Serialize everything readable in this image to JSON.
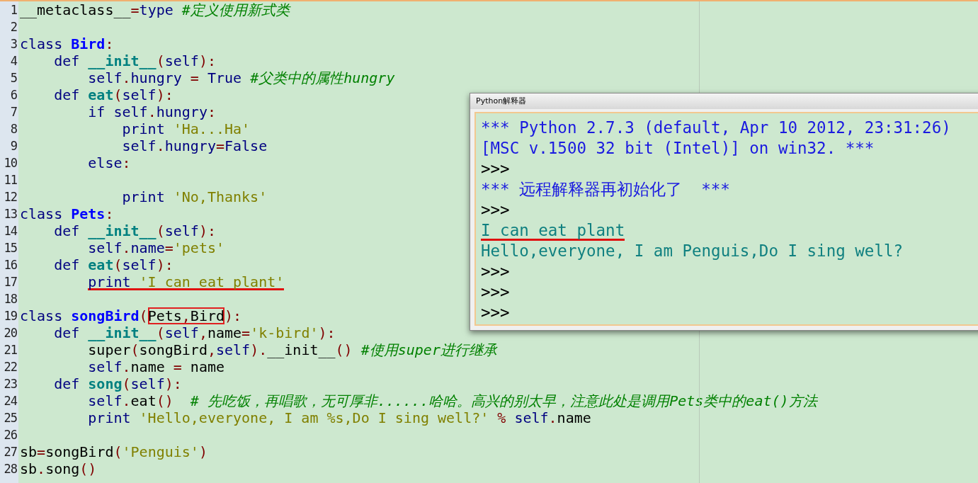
{
  "editor": {
    "lines": [
      {
        "number": "1",
        "tokens": [
          {
            "kind": "name",
            "text": "__metaclass__"
          },
          {
            "kind": "op",
            "text": "="
          },
          {
            "kind": "kw",
            "text": "type "
          },
          {
            "kind": "cmt",
            "text": "#定义使用新式类"
          }
        ]
      },
      {
        "number": "2"
      },
      {
        "number": "3",
        "tokens": [
          {
            "kind": "kw",
            "text": "class "
          },
          {
            "kind": "cls",
            "text": "Bird"
          },
          {
            "kind": "op",
            "text": ":"
          }
        ]
      },
      {
        "number": "4",
        "tokens": [
          {
            "kind": "kw",
            "text": "    def "
          },
          {
            "kind": "fn",
            "text": "__init__"
          },
          {
            "kind": "op",
            "text": "("
          },
          {
            "kind": "kw",
            "text": "self"
          },
          {
            "kind": "op",
            "text": "):"
          }
        ]
      },
      {
        "number": "5",
        "tokens": [
          {
            "kind": "kw",
            "text": "        self"
          },
          {
            "kind": "op",
            "text": "."
          },
          {
            "kind": "kw",
            "text": "hungry "
          },
          {
            "kind": "op",
            "text": "="
          },
          {
            "kind": "kw",
            "text": " True "
          },
          {
            "kind": "cmt",
            "text": "#父类中的属性hungry"
          }
        ]
      },
      {
        "number": "6",
        "tokens": [
          {
            "kind": "kw",
            "text": "    def "
          },
          {
            "kind": "fn",
            "text": "eat"
          },
          {
            "kind": "op",
            "text": "("
          },
          {
            "kind": "kw",
            "text": "self"
          },
          {
            "kind": "op",
            "text": "):"
          }
        ]
      },
      {
        "number": "7",
        "tokens": [
          {
            "kind": "kw",
            "text": "        if self"
          },
          {
            "kind": "op",
            "text": "."
          },
          {
            "kind": "kw",
            "text": "hungry"
          },
          {
            "kind": "op",
            "text": ":"
          }
        ]
      },
      {
        "number": "8",
        "tokens": [
          {
            "kind": "kw",
            "text": "            print "
          },
          {
            "kind": "str",
            "text": "'Ha...Ha'"
          }
        ]
      },
      {
        "number": "9",
        "tokens": [
          {
            "kind": "kw",
            "text": "            self"
          },
          {
            "kind": "op",
            "text": "."
          },
          {
            "kind": "kw",
            "text": "hungry"
          },
          {
            "kind": "op",
            "text": "="
          },
          {
            "kind": "kw",
            "text": "False"
          }
        ]
      },
      {
        "number": "10",
        "tokens": [
          {
            "kind": "kw",
            "text": "        else"
          },
          {
            "kind": "op",
            "text": ":"
          }
        ]
      },
      {
        "number": "11"
      },
      {
        "number": "12",
        "tokens": [
          {
            "kind": "kw",
            "text": "            print "
          },
          {
            "kind": "str",
            "text": "'No,Thanks'"
          }
        ]
      },
      {
        "number": "13",
        "tokens": [
          {
            "kind": "kw",
            "text": "class "
          },
          {
            "kind": "cls",
            "text": "Pets"
          },
          {
            "kind": "op",
            "text": ":"
          }
        ]
      },
      {
        "number": "14",
        "tokens": [
          {
            "kind": "kw",
            "text": "    def "
          },
          {
            "kind": "fn",
            "text": "__init__"
          },
          {
            "kind": "op",
            "text": "("
          },
          {
            "kind": "kw",
            "text": "self"
          },
          {
            "kind": "op",
            "text": "):"
          }
        ]
      },
      {
        "number": "15",
        "tokens": [
          {
            "kind": "kw",
            "text": "        self"
          },
          {
            "kind": "op",
            "text": "."
          },
          {
            "kind": "kw",
            "text": "name"
          },
          {
            "kind": "op",
            "text": "="
          },
          {
            "kind": "str",
            "text": "'pets'"
          }
        ]
      },
      {
        "number": "16",
        "tokens": [
          {
            "kind": "kw",
            "text": "    def "
          },
          {
            "kind": "fn",
            "text": "eat"
          },
          {
            "kind": "op",
            "text": "("
          },
          {
            "kind": "kw",
            "text": "self"
          },
          {
            "kind": "op",
            "text": "):"
          }
        ]
      },
      {
        "number": "17",
        "tokens": [
          {
            "underlined": true,
            "boxed": false,
            "parts": [
              {
                "kind": "kw",
                "text": "        print "
              },
              {
                "kind": "str",
                "text": "'I can eat plant'"
              }
            ]
          }
        ]
      },
      {
        "number": "18"
      },
      {
        "number": "19",
        "tokens": [
          {
            "kind": "kw",
            "text": "class "
          },
          {
            "kind": "cls",
            "text": "songBird"
          },
          {
            "kind": "op",
            "text": "("
          },
          {
            "underlined": false,
            "boxed": true,
            "parts": [
              {
                "kind": "name",
                "text": "Pets"
              },
              {
                "kind": "op",
                "text": ","
              },
              {
                "kind": "name",
                "text": "Bird"
              }
            ]
          },
          {
            "kind": "op",
            "text": "):"
          }
        ]
      },
      {
        "number": "20",
        "tokens": [
          {
            "kind": "kw",
            "text": "    def "
          },
          {
            "kind": "fn",
            "text": "__init__"
          },
          {
            "kind": "op",
            "text": "("
          },
          {
            "kind": "kw",
            "text": "self"
          },
          {
            "kind": "op",
            "text": ","
          },
          {
            "kind": "name",
            "text": "name"
          },
          {
            "kind": "op",
            "text": "="
          },
          {
            "kind": "str",
            "text": "'k-bird'"
          },
          {
            "kind": "op",
            "text": "):"
          }
        ]
      },
      {
        "number": "21",
        "tokens": [
          {
            "kind": "name",
            "text": "        super"
          },
          {
            "kind": "op",
            "text": "("
          },
          {
            "kind": "name",
            "text": "songBird"
          },
          {
            "kind": "op",
            "text": ","
          },
          {
            "kind": "kw",
            "text": "self"
          },
          {
            "kind": "op",
            "text": ")."
          },
          {
            "kind": "name",
            "text": "__init__"
          },
          {
            "kind": "op",
            "text": "() "
          },
          {
            "kind": "cmt",
            "text": "#使用super进行继承"
          }
        ]
      },
      {
        "number": "22",
        "tokens": [
          {
            "kind": "kw",
            "text": "        self"
          },
          {
            "kind": "op",
            "text": "."
          },
          {
            "kind": "name",
            "text": "name "
          },
          {
            "kind": "op",
            "text": "="
          },
          {
            "kind": "name",
            "text": " name"
          }
        ]
      },
      {
        "number": "23",
        "tokens": [
          {
            "kind": "kw",
            "text": "    def "
          },
          {
            "kind": "fn",
            "text": "song"
          },
          {
            "kind": "op",
            "text": "("
          },
          {
            "kind": "kw",
            "text": "self"
          },
          {
            "kind": "op",
            "text": "):"
          }
        ]
      },
      {
        "number": "24",
        "tokens": [
          {
            "kind": "kw",
            "text": "        self"
          },
          {
            "kind": "op",
            "text": "."
          },
          {
            "kind": "name",
            "text": "eat"
          },
          {
            "kind": "op",
            "text": "()  "
          },
          {
            "kind": "cmt",
            "text": "# 先吃饭，再唱歌，无可厚非......哈哈。高兴的别太早，注意此处是调用Pets类中的eat()方法"
          }
        ]
      },
      {
        "number": "25",
        "tokens": [
          {
            "kind": "kw",
            "text": "        print "
          },
          {
            "kind": "str",
            "text": "'Hello,everyone, I am %s,Do I sing well?'"
          },
          {
            "kind": "op",
            "text": " % "
          },
          {
            "kind": "kw",
            "text": "self"
          },
          {
            "kind": "op",
            "text": "."
          },
          {
            "kind": "name",
            "text": "name"
          }
        ]
      },
      {
        "number": "26"
      },
      {
        "number": "27",
        "tokens": [
          {
            "kind": "name",
            "text": "sb"
          },
          {
            "kind": "op",
            "text": "="
          },
          {
            "kind": "name",
            "text": "songBird"
          },
          {
            "kind": "op",
            "text": "("
          },
          {
            "kind": "str",
            "text": "'Penguis'"
          },
          {
            "kind": "op",
            "text": ")"
          }
        ]
      },
      {
        "number": "28",
        "tokens": [
          {
            "kind": "name",
            "text": "sb"
          },
          {
            "kind": "op",
            "text": "."
          },
          {
            "kind": "name",
            "text": "song"
          },
          {
            "kind": "op",
            "text": "()"
          }
        ]
      }
    ]
  },
  "console": {
    "title": "Python解释器",
    "lines": [
      {
        "kind": "banner",
        "text": "*** Python 2.7.3 (default, Apr 10 2012, 23:31:26)"
      },
      {
        "kind": "banner",
        "text": "[MSC v.1500 32 bit (Intel)] on win32. ***"
      },
      {
        "kind": "prompt",
        "text": ">>>"
      },
      {
        "kind": "banner",
        "text": "*** 远程解释器再初始化了  ***"
      },
      {
        "kind": "prompt",
        "text": ">>>"
      },
      {
        "kind": "output",
        "text": "I can eat plant",
        "underlined": true
      },
      {
        "kind": "output",
        "text": "Hello,everyone, I am Penguis,Do I sing well?"
      },
      {
        "kind": "prompt",
        "text": ">>>"
      },
      {
        "kind": "prompt",
        "text": ">>>"
      },
      {
        "kind": "prompt",
        "text": ">>>"
      }
    ]
  }
}
